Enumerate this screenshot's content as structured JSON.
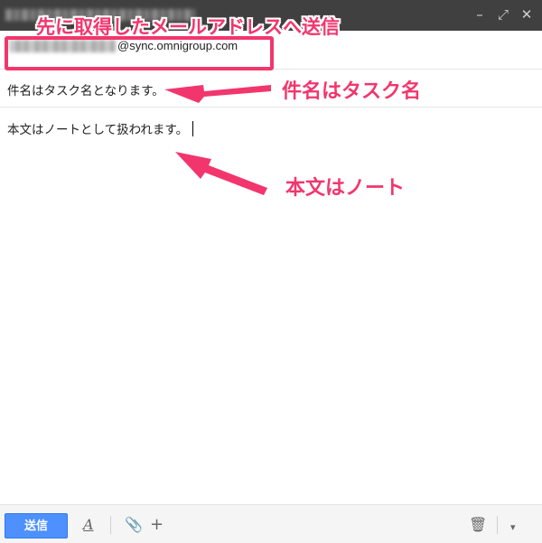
{
  "window": {
    "icons": [
      "minimize-icon",
      "popout-icon",
      "close-icon"
    ],
    "icon_glyphs": {
      "minimize": "–",
      "popout": "⤢",
      "close": "✕"
    }
  },
  "compose": {
    "to_domain": "@sync.omnigroup.com",
    "subject": "件名はタスク名となります。",
    "body": "本文はノートとして扱われます。"
  },
  "annotations": {
    "to_label": "先に取得したメールアドレスへ送信",
    "subject_label": "件名はタスク名",
    "body_label": "本文はノート",
    "color": "#f2366d"
  },
  "toolbar": {
    "send_label": "送信",
    "send_color": "#4d90fe",
    "format_glyph": "A",
    "attach_glyph": "📎",
    "plus_glyph": "+",
    "trash_glyph": "🗑",
    "more_glyph": "▾"
  }
}
